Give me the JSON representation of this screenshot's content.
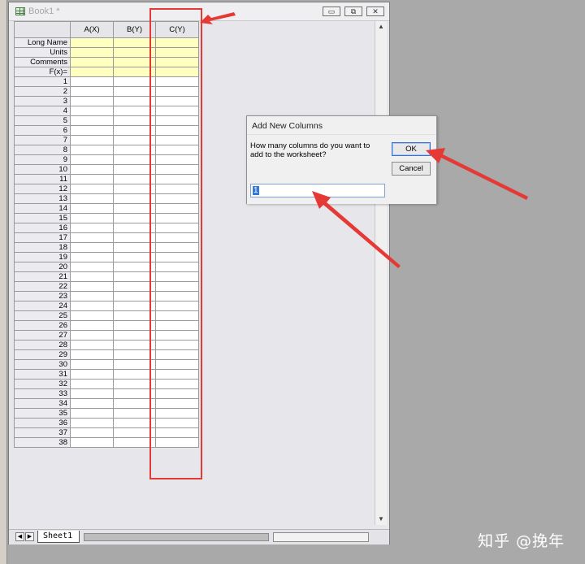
{
  "window": {
    "title": "Book1 *",
    "controls": {
      "minimize": "▭",
      "restore": "⧉",
      "close": "✕"
    }
  },
  "grid": {
    "columns": [
      "A(X)",
      "B(Y)",
      "C(Y)"
    ],
    "meta_rows": [
      "Long Name",
      "Units",
      "Comments",
      "F(x)="
    ],
    "row_numbers": [
      "1",
      "2",
      "3",
      "4",
      "5",
      "6",
      "7",
      "8",
      "9",
      "10",
      "11",
      "12",
      "13",
      "14",
      "15",
      "16",
      "17",
      "18",
      "19",
      "20",
      "21",
      "22",
      "23",
      "24",
      "25",
      "26",
      "27",
      "28",
      "29",
      "30",
      "31",
      "32",
      "33",
      "34",
      "35",
      "36",
      "37",
      "38"
    ]
  },
  "sheet": {
    "tab_label": "Sheet1"
  },
  "dialog": {
    "title": "Add New Columns",
    "prompt": "How many columns do you want to add to the worksheet?",
    "ok_label": "OK",
    "cancel_label": "Cancel",
    "input_value": "1"
  },
  "watermark": "知乎 @挽年",
  "colors": {
    "annotation": "#e53935",
    "meta_fill": "#ffffc0",
    "selection": "#3478d8"
  }
}
